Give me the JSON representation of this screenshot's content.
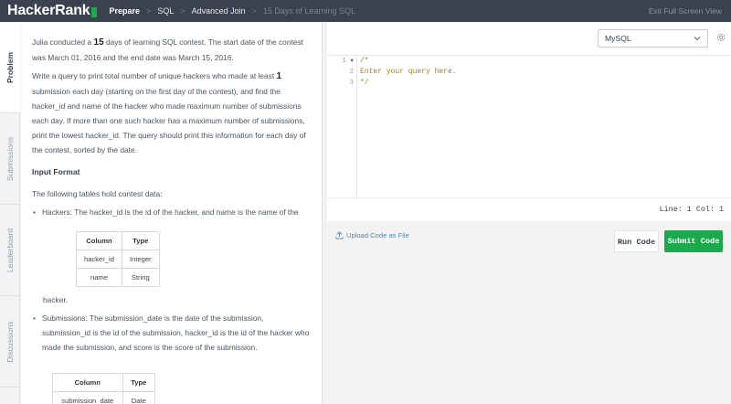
{
  "brand": {
    "logo_text": "HackerRank",
    "accent": "#1ba94c"
  },
  "breadcrumbs": [
    "Prepare",
    "SQL",
    "Advanced Join",
    "15 Days of Learning SQL"
  ],
  "top_right": {
    "exit_label": "Exit Full Screen View"
  },
  "side_tabs": [
    "Problem",
    "Submissions",
    "Leaderboard",
    "Discussions"
  ],
  "problem": {
    "intro_a": "Julia conducted a ",
    "intro_num": "15",
    "intro_b": " days of learning SQL contest. The start date of the contest was March 01, 2016 and the end date was March 15, 2016.",
    "task_a": "Write a query to print total number of unique hackers who made at least ",
    "task_num": "1",
    "task_b": " submission each day (starting on the first day of the contest), and find the hacker_id and name of the hacker who made maximum number of submissions each day. If more than one such hacker has a maximum number of submissions, print the lowest hacker_id. The query should print this information for each day of the contest, sorted by the date.",
    "input_format_heading": "Input Format",
    "tables_intro": "The following tables hold contest data:",
    "hackers_desc": "Hackers: The hacker_id is the id of the hacker, and name is the name of the",
    "hackers_after": "hacker.",
    "hackers_table": {
      "headers": [
        "Column",
        "Type"
      ],
      "rows": [
        [
          "hacker_id",
          "Integer"
        ],
        [
          "name",
          "String"
        ]
      ]
    },
    "submissions_desc": "Submissions: The submission_date is the date of the submission, submission_id is the id of the submission, hacker_id is the id of the hacker who made the submission, and score is the score of the submission.",
    "submissions_table": {
      "headers": [
        "Column",
        "Type"
      ],
      "rows": [
        [
          "submission_date",
          "Date"
        ]
      ]
    }
  },
  "editor": {
    "language": "MySQL",
    "line_numbers": [
      "1",
      "2",
      "3"
    ],
    "fold_marker": "▼",
    "code_lines": [
      "/*",
      "Enter your query here.",
      "*/"
    ],
    "status": "Line: 1 Col: 1"
  },
  "actions": {
    "upload_label": "Upload Code as File",
    "run_label": "Run Code",
    "submit_label": "Submit Code"
  }
}
